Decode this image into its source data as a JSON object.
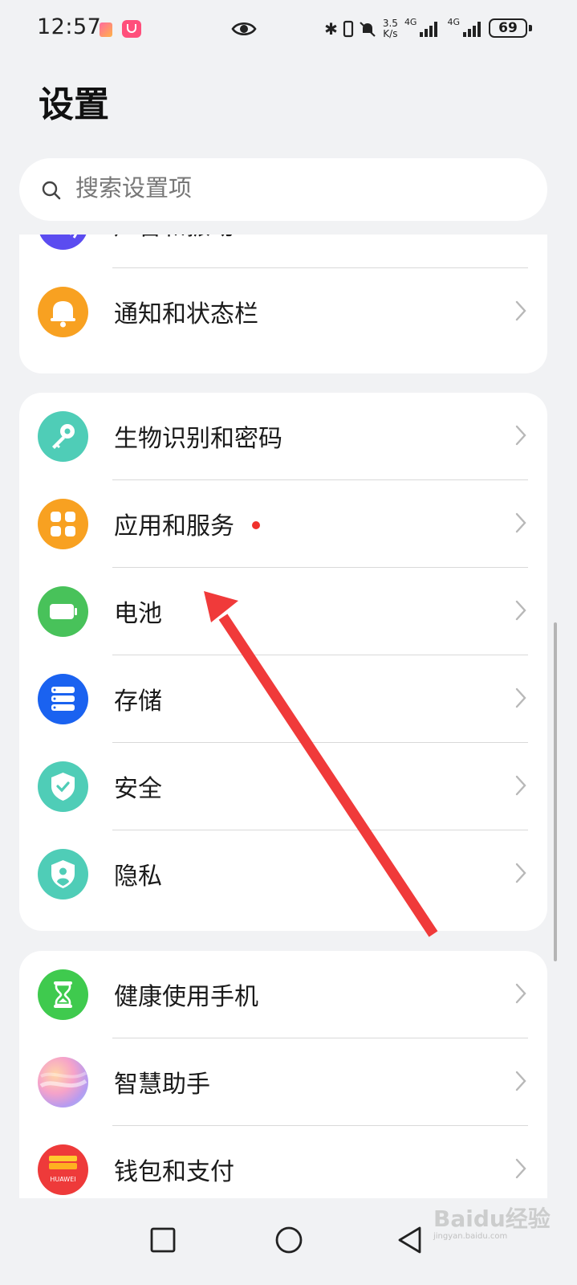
{
  "status_bar": {
    "time": "12:57",
    "net_speed_top": "3.5",
    "net_speed_bottom": "K/s",
    "network_1": "4G",
    "network_2": "4G",
    "battery": "69"
  },
  "page": {
    "title": "设置"
  },
  "search": {
    "placeholder": "搜索设置项"
  },
  "groups": [
    {
      "items": [
        {
          "label": "声音和振动",
          "icon": "sound-wave-icon",
          "color": "#5b4cf0"
        },
        {
          "label": "通知和状态栏",
          "icon": "bell-icon",
          "color": "#f8a121"
        }
      ]
    },
    {
      "items": [
        {
          "label": "生物识别和密码",
          "icon": "key-icon",
          "color": "#4fcdb7"
        },
        {
          "label": "应用和服务",
          "icon": "apps-grid-icon",
          "color": "#f8a121",
          "badge": true
        },
        {
          "label": "电池",
          "icon": "battery-icon",
          "color": "#48c25a"
        },
        {
          "label": "存储",
          "icon": "storage-icon",
          "color": "#1a62f0"
        },
        {
          "label": "安全",
          "icon": "shield-check-icon",
          "color": "#4fcdb7"
        },
        {
          "label": "隐私",
          "icon": "privacy-shield-icon",
          "color": "#4fcdb7"
        }
      ]
    },
    {
      "items": [
        {
          "label": "健康使用手机",
          "icon": "hourglass-icon",
          "color": "#3fca4e"
        },
        {
          "label": "智慧助手",
          "icon": "assistant-orb-icon",
          "color": "#e9a3c7"
        },
        {
          "label": "钱包和支付",
          "icon": "huawei-wallet-icon",
          "color": "#ee3a3a",
          "icon_text": "HUAWEI"
        }
      ]
    }
  ],
  "annotation_color": "#f03a3a",
  "watermark": {
    "text": "Baidu经验",
    "sub": "jingyan.baidu.com"
  }
}
